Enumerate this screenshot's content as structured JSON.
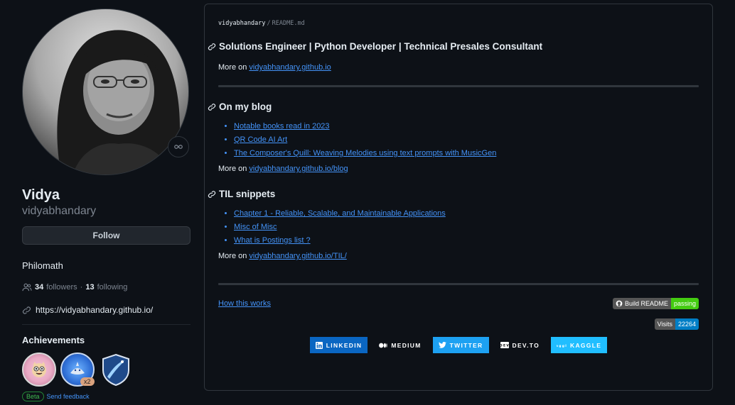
{
  "profile": {
    "full_name": "Vidya",
    "username": "vidyabhandary",
    "follow_label": "Follow",
    "bio": "Philomath",
    "followers_count": "34",
    "followers_label": "followers",
    "separator": "·",
    "following_count": "13",
    "following_label": "following",
    "website": "https://vidyabhandary.github.io/",
    "achievements_title": "Achievements",
    "badge_multiplier": "x2",
    "beta_label": "Beta",
    "feedback_label": "Send feedback"
  },
  "readme": {
    "crumb_user": "vidyabhandary",
    "crumb_sep": "/",
    "crumb_file": "README.md",
    "headline": "Solutions Engineer | Python Developer | Technical Presales Consultant",
    "more_prefix": "More on",
    "main_link": "vidyabhandary.github.io",
    "blog": {
      "title": "On my blog",
      "items": [
        "Notable books read in 2023",
        "QR Code AI Art",
        "The Composer's Quill: Weaving Melodies using text prompts with MusicGen"
      ],
      "more_link": "vidyabhandary.github.io/blog"
    },
    "til": {
      "title": "TIL snippets",
      "items": [
        "Chapter 1 - Reliable, Scalable, and Maintainable Applications",
        "Misc of Misc",
        "What is Postings list ?"
      ],
      "more_link": "vidyabhandary.github.io/TIL/"
    },
    "how_link": "How this works",
    "build_badge": {
      "label": "Build README",
      "status": "passing",
      "status_color": "#4c1"
    },
    "visits_badge": {
      "label": "Visits",
      "count": "22264",
      "count_color": "#007ec6"
    },
    "social": [
      {
        "label": "LINKEDIN",
        "color": "#0a66c2",
        "icon": "linkedin-icon"
      },
      {
        "label": "MEDIUM",
        "color": "#0d1117",
        "icon": "medium-icon"
      },
      {
        "label": "TWITTER",
        "color": "#1da1f2",
        "icon": "twitter-icon"
      },
      {
        "label": "DEV.TO",
        "color": "#0d1117",
        "icon": "devto-icon"
      },
      {
        "label": "KAGGLE",
        "color": "#20beff",
        "icon": "kaggle-icon"
      }
    ]
  },
  "colors": {
    "background": "#0d1117",
    "link": "#4493f8",
    "border": "#30363d",
    "muted": "#7d8590"
  }
}
